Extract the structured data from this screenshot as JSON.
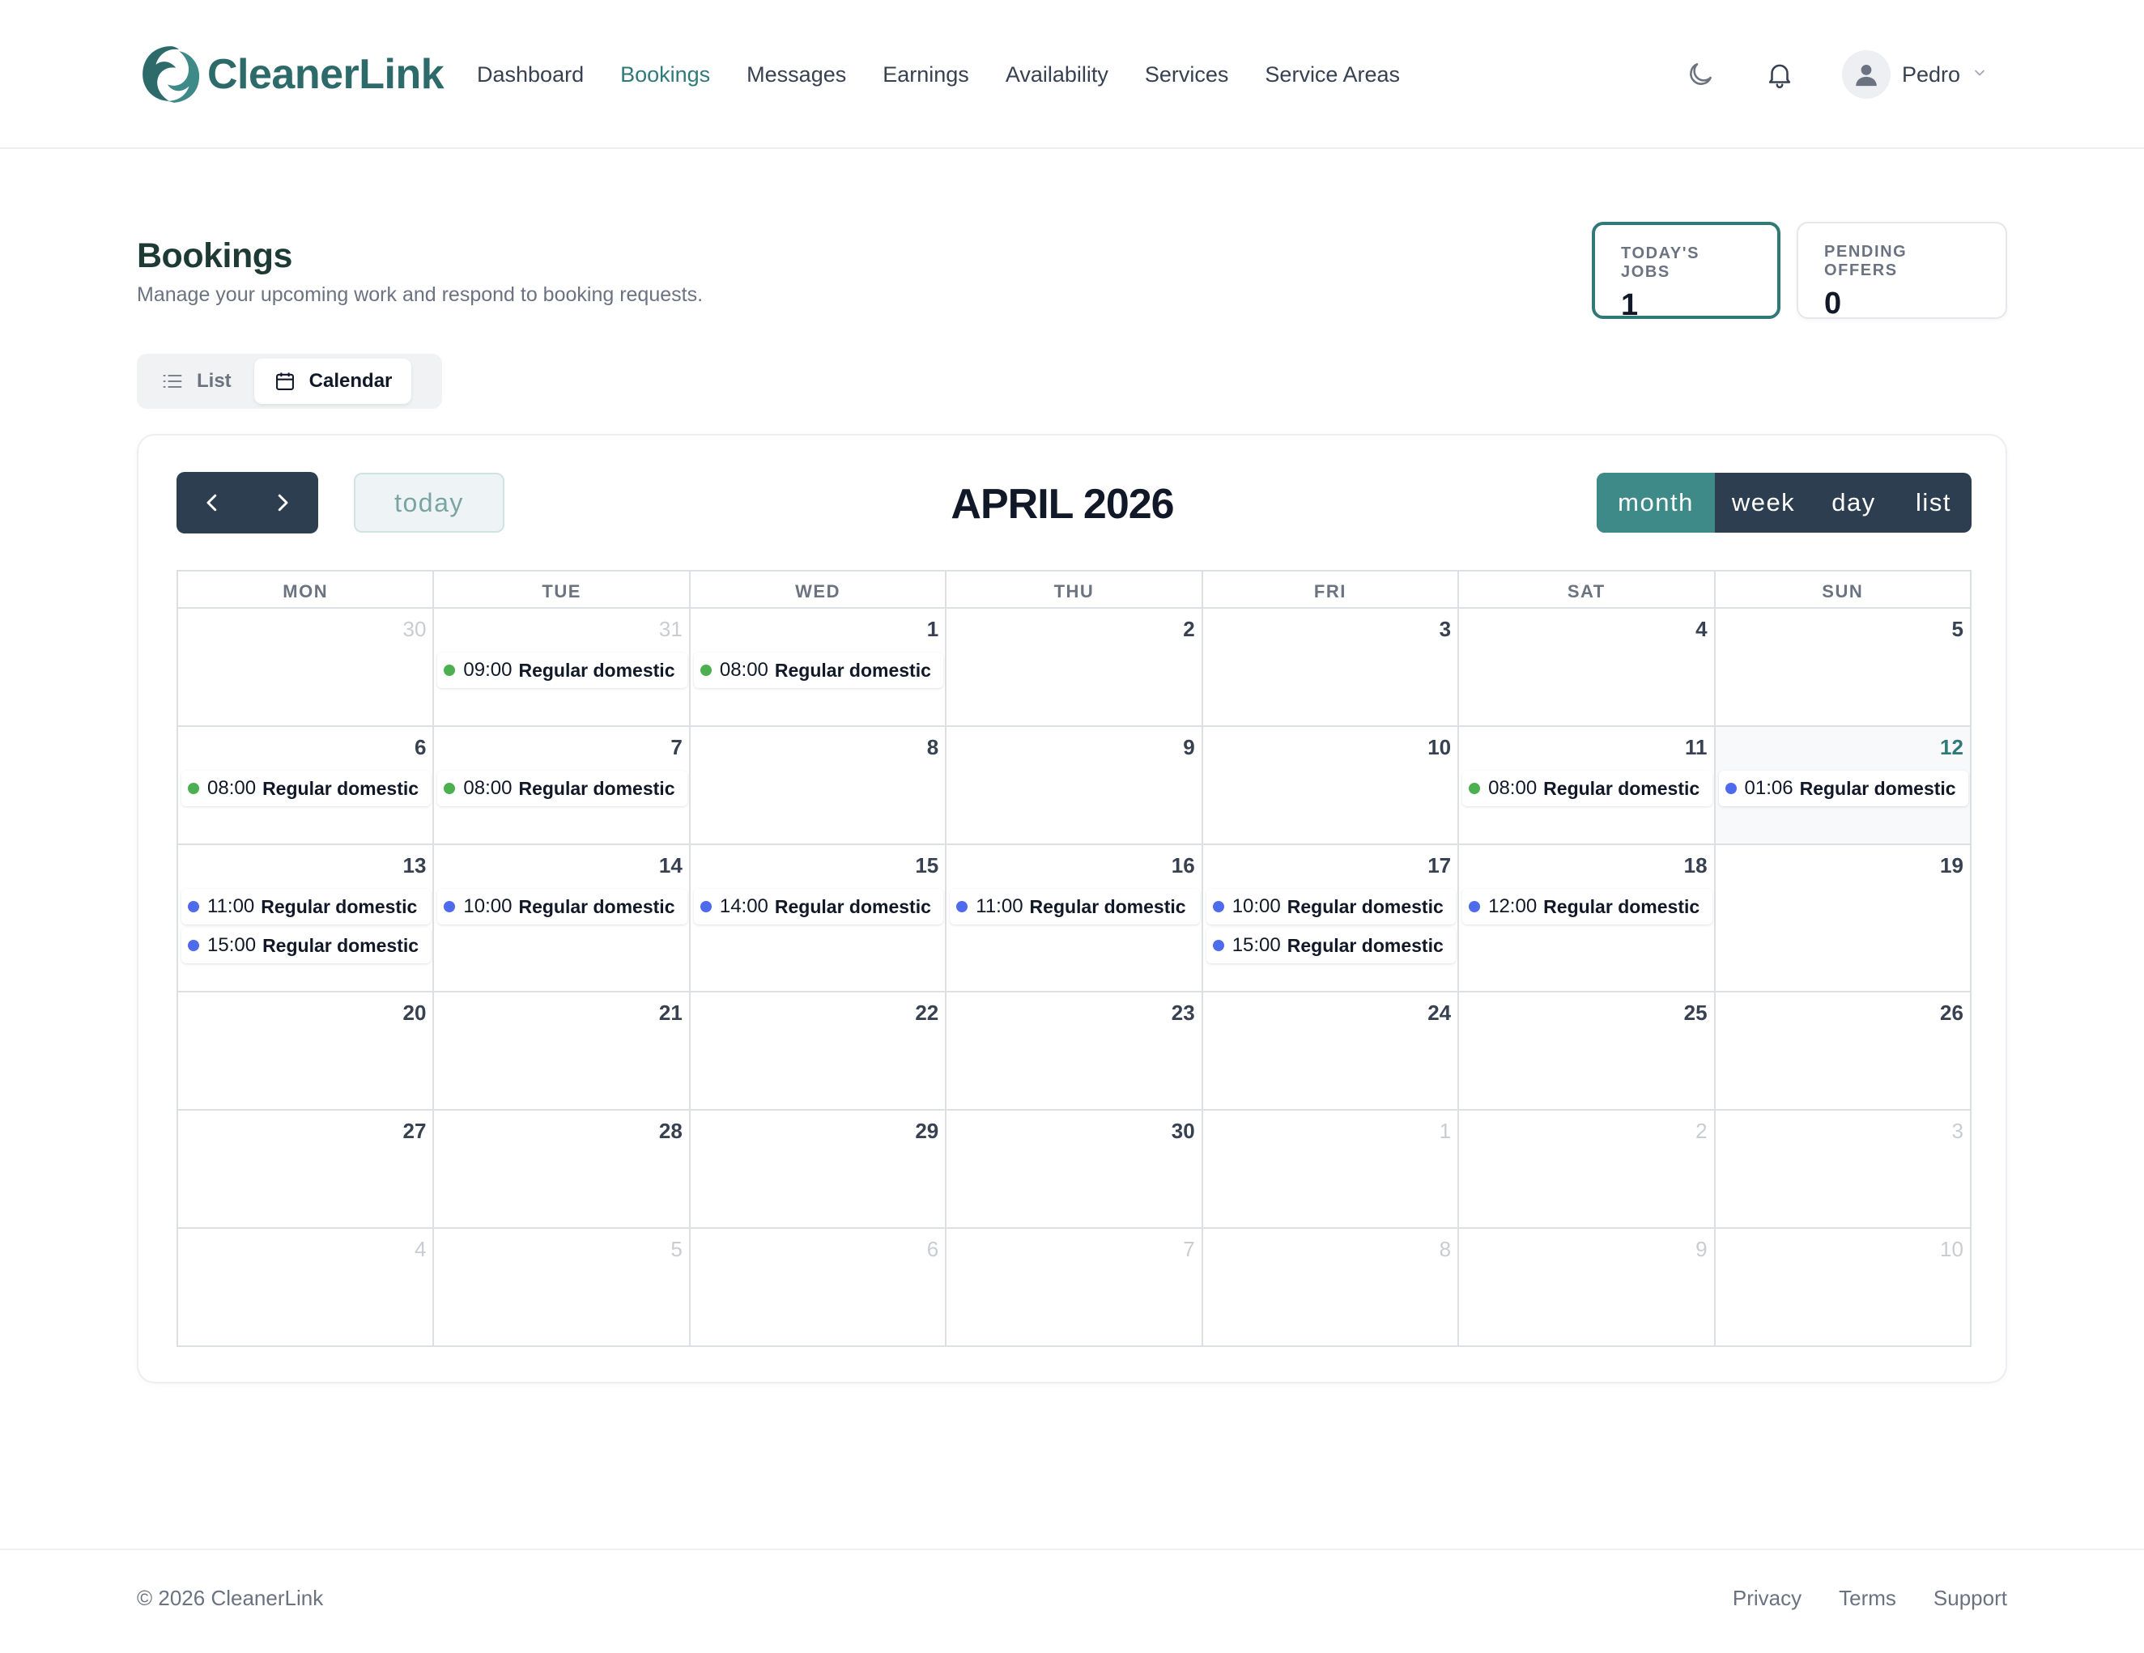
{
  "header": {
    "brand": "CleanerLink",
    "nav": [
      {
        "label": "Dashboard",
        "active": false
      },
      {
        "label": "Bookings",
        "active": true
      },
      {
        "label": "Messages",
        "active": false
      },
      {
        "label": "Earnings",
        "active": false
      },
      {
        "label": "Availability",
        "active": false
      },
      {
        "label": "Services",
        "active": false
      },
      {
        "label": "Service Areas",
        "active": false
      }
    ],
    "theme_icon": "moon-icon",
    "notifications_icon": "bell-icon",
    "user_name": "Pedro"
  },
  "page": {
    "title": "Bookings",
    "subtitle": "Manage your upcoming work and respond to booking requests.",
    "stats": [
      {
        "label": "TODAY'S JOBS",
        "value": "1"
      },
      {
        "label": "PENDING OFFERS",
        "value": "0"
      }
    ],
    "view_toggle": {
      "list_label": "List",
      "calendar_label": "Calendar",
      "active": "Calendar"
    }
  },
  "calendar": {
    "title": "APRIL 2026",
    "today_label": "today",
    "views": [
      {
        "label": "month",
        "active": true
      },
      {
        "label": "week",
        "active": false
      },
      {
        "label": "day",
        "active": false
      },
      {
        "label": "list",
        "active": false
      }
    ],
    "weekdays": [
      "MON",
      "TUE",
      "WED",
      "THU",
      "FRI",
      "SAT",
      "SUN"
    ],
    "colors": {
      "completed": "#4caf50",
      "upcoming": "#4f6bed",
      "accent": "#2f7a78"
    },
    "weeks": [
      [
        {
          "num": "30",
          "other": true,
          "events": []
        },
        {
          "num": "31",
          "other": true,
          "events": [
            {
              "time": "09:00",
              "title": "Regular domestic",
              "status": "completed"
            }
          ]
        },
        {
          "num": "1",
          "events": [
            {
              "time": "08:00",
              "title": "Regular domestic",
              "status": "completed"
            }
          ]
        },
        {
          "num": "2",
          "events": []
        },
        {
          "num": "3",
          "events": []
        },
        {
          "num": "4",
          "events": []
        },
        {
          "num": "5",
          "events": []
        }
      ],
      [
        {
          "num": "6",
          "events": [
            {
              "time": "08:00",
              "title": "Regular domestic",
              "status": "completed"
            }
          ]
        },
        {
          "num": "7",
          "events": [
            {
              "time": "08:00",
              "title": "Regular domestic",
              "status": "completed"
            }
          ]
        },
        {
          "num": "8",
          "events": []
        },
        {
          "num": "9",
          "events": []
        },
        {
          "num": "10",
          "events": []
        },
        {
          "num": "11",
          "events": [
            {
              "time": "08:00",
              "title": "Regular domestic",
              "status": "completed"
            }
          ]
        },
        {
          "num": "12",
          "today": true,
          "events": [
            {
              "time": "01:06",
              "title": "Regular domestic",
              "status": "upcoming"
            }
          ]
        }
      ],
      [
        {
          "num": "13",
          "events": [
            {
              "time": "11:00",
              "title": "Regular domestic",
              "status": "upcoming"
            },
            {
              "time": "15:00",
              "title": "Regular domestic",
              "status": "upcoming"
            }
          ]
        },
        {
          "num": "14",
          "events": [
            {
              "time": "10:00",
              "title": "Regular domestic",
              "status": "upcoming"
            }
          ]
        },
        {
          "num": "15",
          "events": [
            {
              "time": "14:00",
              "title": "Regular domestic",
              "status": "upcoming"
            }
          ]
        },
        {
          "num": "16",
          "events": [
            {
              "time": "11:00",
              "title": "Regular domestic",
              "status": "upcoming"
            }
          ]
        },
        {
          "num": "17",
          "events": [
            {
              "time": "10:00",
              "title": "Regular domestic",
              "status": "upcoming"
            },
            {
              "time": "15:00",
              "title": "Regular domestic",
              "status": "upcoming"
            }
          ]
        },
        {
          "num": "18",
          "events": [
            {
              "time": "12:00",
              "title": "Regular domestic",
              "status": "upcoming"
            }
          ]
        },
        {
          "num": "19",
          "events": []
        }
      ],
      [
        {
          "num": "20",
          "events": []
        },
        {
          "num": "21",
          "events": []
        },
        {
          "num": "22",
          "events": []
        },
        {
          "num": "23",
          "events": []
        },
        {
          "num": "24",
          "events": []
        },
        {
          "num": "25",
          "events": []
        },
        {
          "num": "26",
          "events": []
        }
      ],
      [
        {
          "num": "27",
          "events": []
        },
        {
          "num": "28",
          "events": []
        },
        {
          "num": "29",
          "events": []
        },
        {
          "num": "30",
          "events": []
        },
        {
          "num": "1",
          "other": true,
          "events": []
        },
        {
          "num": "2",
          "other": true,
          "events": []
        },
        {
          "num": "3",
          "other": true,
          "events": []
        }
      ],
      [
        {
          "num": "4",
          "other": true,
          "events": []
        },
        {
          "num": "5",
          "other": true,
          "events": []
        },
        {
          "num": "6",
          "other": true,
          "events": []
        },
        {
          "num": "7",
          "other": true,
          "events": []
        },
        {
          "num": "8",
          "other": true,
          "events": []
        },
        {
          "num": "9",
          "other": true,
          "events": []
        },
        {
          "num": "10",
          "other": true,
          "events": []
        }
      ]
    ]
  },
  "footer": {
    "copyright": "© 2026 CleanerLink",
    "links": [
      "Privacy",
      "Terms",
      "Support"
    ]
  }
}
